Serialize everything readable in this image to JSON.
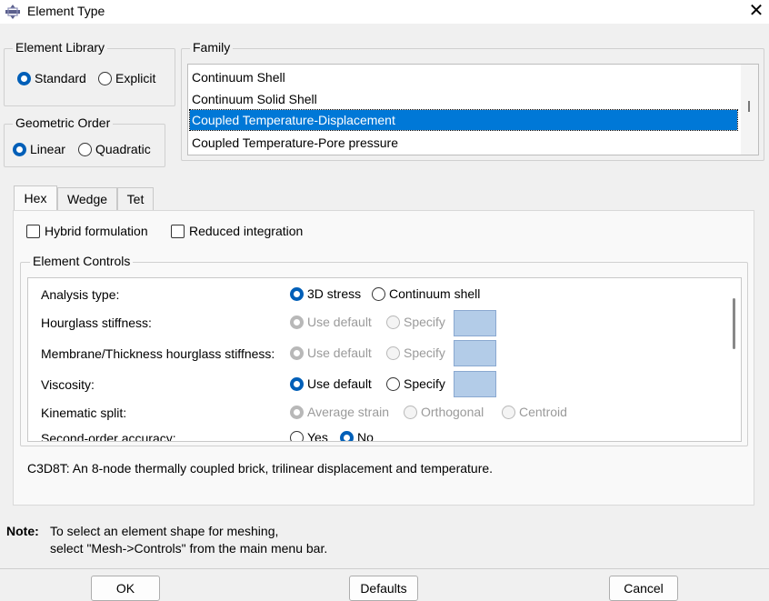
{
  "window": {
    "title": "Element Type"
  },
  "element_library": {
    "label": "Element Library",
    "options": [
      "Standard",
      "Explicit"
    ],
    "selected": "Standard"
  },
  "geometric_order": {
    "label": "Geometric Order",
    "options": [
      "Linear",
      "Quadratic"
    ],
    "selected": "Linear"
  },
  "family": {
    "label": "Family",
    "items": [
      "Continuum Shell",
      "Continuum Solid Shell",
      "Coupled Temperature-Displacement",
      "Coupled Temperature-Pore pressure"
    ],
    "selected_index": 2
  },
  "tabs": [
    "Hex",
    "Wedge",
    "Tet"
  ],
  "active_tab": "Hex",
  "checkboxes": {
    "hybrid": "Hybrid formulation",
    "reduced": "Reduced integration"
  },
  "element_controls": {
    "label": "Element Controls",
    "rows": [
      {
        "label": "Analysis type:",
        "options": [
          "3D stress",
          "Continuum shell"
        ]
      },
      {
        "label": "Hourglass stiffness:",
        "options": [
          "Use default",
          "Specify"
        ]
      },
      {
        "label": "Membrane/Thickness hourglass stiffness:",
        "options": [
          "Use default",
          "Specify"
        ]
      },
      {
        "label": "Viscosity:",
        "options": [
          "Use default",
          "Specify"
        ]
      },
      {
        "label": "Kinematic split:",
        "options": [
          "Average strain",
          "Orthogonal",
          "Centroid"
        ]
      },
      {
        "label": "Second-order accuracy:",
        "options": [
          "Yes",
          "No"
        ]
      }
    ]
  },
  "description": "C3D8T:  An 8-node thermally coupled brick, trilinear displacement and temperature.",
  "note": {
    "label": "Note:",
    "line1": "To select an element shape for meshing,",
    "line2": "select \"Mesh->Controls\" from the main menu bar."
  },
  "buttons": {
    "ok": "OK",
    "defaults": "Defaults",
    "cancel": "Cancel"
  },
  "colors": {
    "accent": "#005fb8",
    "selection": "#0078d7",
    "swatch": "#b3cce8"
  }
}
